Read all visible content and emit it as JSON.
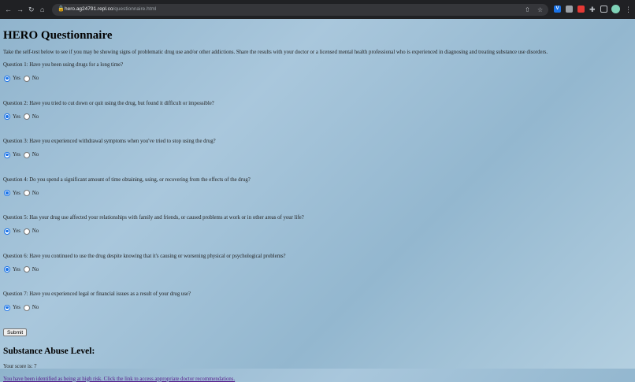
{
  "browser": {
    "url_host": "hero.ag24791.repl.co",
    "url_path": "/questionnaire.html"
  },
  "page": {
    "title": "HERO Questionnaire",
    "intro": "Take the self-test below to see if you may be showing signs of problematic drug use and/or other addictions. Share the results with your doctor or a licensed mental health professional who is experienced in diagnosing and treating substance use disorders.",
    "yes_label": "Yes",
    "no_label": "No",
    "questions": [
      {
        "text": "Question 1: Have you been using drugs for a long time?",
        "selected": "Yes"
      },
      {
        "text": "Question 2: Have you tried to cut down or quit using the drug, but found it difficult or impossible?",
        "selected": "Yes"
      },
      {
        "text": "Question 3: Have you experienced withdrawal symptoms when you've tried to stop using the drug?",
        "selected": "Yes"
      },
      {
        "text": "Question 4: Do you spend a significant amount of time obtaining, using, or recovering from the effects of the drug?",
        "selected": "Yes"
      },
      {
        "text": "Question 5: Has your drug use affected your relationships with family and friends, or caused problems at work or in other areas of your life?",
        "selected": "Yes"
      },
      {
        "text": "Question 6: Have you continued to use the drug despite knowing that it's causing or worsening physical or psychological problems?",
        "selected": "Yes"
      },
      {
        "text": "Question 7: Have you experienced legal or financial issues as a result of your drug use?",
        "selected": "Yes"
      }
    ],
    "submit_label": "Submit",
    "level_heading": "Substance Abuse Level:",
    "score_text": "Your score is: 7",
    "risk_link": "You have been identified as being at high risk. Click the link to access appropriate doctor recommendations."
  }
}
